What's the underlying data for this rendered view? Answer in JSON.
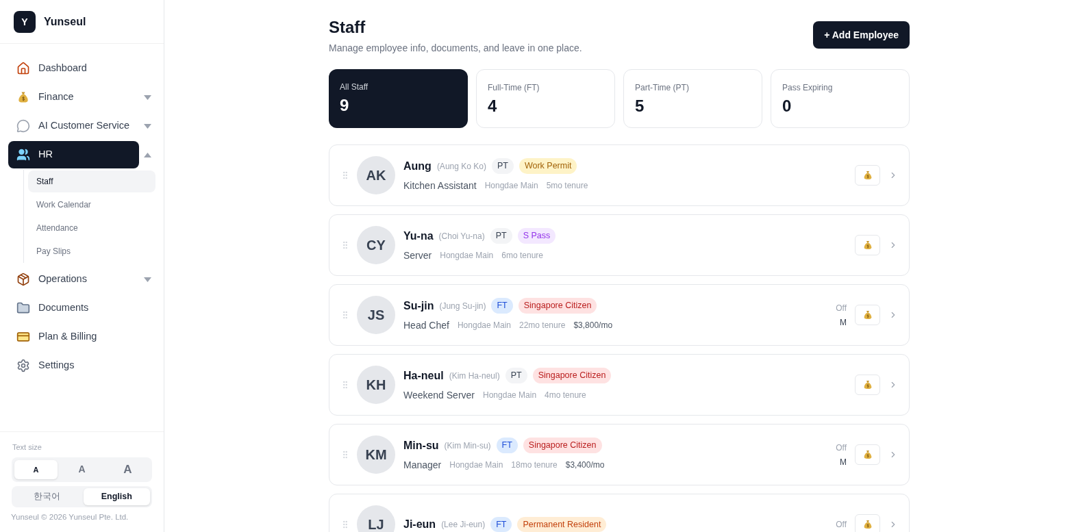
{
  "brand": {
    "logo_letter": "Y",
    "name": "Yunseul"
  },
  "nav": [
    {
      "label": "Dashboard",
      "kind": "link",
      "selected": false
    },
    {
      "label": "Finance",
      "kind": "group",
      "selected": false,
      "expanded": false
    },
    {
      "label": "AI Customer Service",
      "kind": "group",
      "selected": false,
      "expanded": false
    },
    {
      "label": "HR",
      "kind": "group",
      "selected": true,
      "expanded": true,
      "children": [
        {
          "label": "Staff",
          "selected": true
        },
        {
          "label": "Work Calendar",
          "selected": false
        },
        {
          "label": "Attendance",
          "selected": false
        },
        {
          "label": "Pay Slips",
          "selected": false
        }
      ]
    },
    {
      "label": "Operations",
      "kind": "group",
      "selected": false,
      "expanded": false
    },
    {
      "label": "Documents",
      "kind": "link",
      "selected": false
    },
    {
      "label": "Plan & Billing",
      "kind": "link",
      "selected": false
    },
    {
      "label": "Settings",
      "kind": "link",
      "selected": false
    }
  ],
  "text_size": {
    "label": "Text size",
    "options": [
      {
        "label": "A",
        "selected": true
      },
      {
        "label": "A",
        "selected": false
      },
      {
        "label": "A",
        "selected": false
      }
    ]
  },
  "language": [
    {
      "label": "한국어",
      "selected": false
    },
    {
      "label": "English",
      "selected": true
    }
  ],
  "footer": "Yunseul © 2026 Yunseul Pte. Ltd.",
  "page": {
    "title": "Staff",
    "subtitle": "Manage employee info, documents, and leave in one place.",
    "action": "+ Add Employee"
  },
  "stats": [
    {
      "label": "All Staff",
      "value": "9",
      "selected": true
    },
    {
      "label": "Full-Time (FT)",
      "value": "4",
      "selected": false
    },
    {
      "label": "Part-Time (PT)",
      "value": "5",
      "selected": false
    },
    {
      "label": "Pass Expiring",
      "value": "0",
      "selected": false
    }
  ],
  "employees": [
    {
      "initials": "AK",
      "name": "Aung",
      "full_name": "(Aung Ko Ko)",
      "type": {
        "label": "PT",
        "kind": "pt"
      },
      "status": {
        "label": "Work Permit",
        "kind": "work_permit"
      },
      "role": "Kitchen Assistant",
      "branch": "Hongdae Main",
      "tenure": "5mo tenure"
    },
    {
      "initials": "CY",
      "name": "Yu-na",
      "full_name": "(Choi Yu-na)",
      "type": {
        "label": "PT",
        "kind": "pt"
      },
      "status": {
        "label": "S Pass",
        "kind": "s_pass"
      },
      "role": "Server",
      "branch": "Hongdae Main",
      "tenure": "6mo tenure"
    },
    {
      "initials": "JS",
      "name": "Su-jin",
      "full_name": "(Jung Su-jin)",
      "type": {
        "label": "FT",
        "kind": "ft"
      },
      "status": {
        "label": "Singapore Citizen",
        "kind": "citizen"
      },
      "role": "Head Chef",
      "branch": "Hongdae Main",
      "tenure": "22mo tenure",
      "salary": "$3,800/mo",
      "off": {
        "label": "Off",
        "day": "M"
      }
    },
    {
      "initials": "KH",
      "name": "Ha-neul",
      "full_name": "(Kim Ha-neul)",
      "type": {
        "label": "PT",
        "kind": "pt"
      },
      "status": {
        "label": "Singapore Citizen",
        "kind": "citizen"
      },
      "role": "Weekend Server",
      "branch": "Hongdae Main",
      "tenure": "4mo tenure"
    },
    {
      "initials": "KM",
      "name": "Min-su",
      "full_name": "(Kim Min-su)",
      "type": {
        "label": "FT",
        "kind": "ft"
      },
      "status": {
        "label": "Singapore Citizen",
        "kind": "citizen"
      },
      "role": "Manager",
      "branch": "Hongdae Main",
      "tenure": "18mo tenure",
      "salary": "$3,400/mo",
      "off": {
        "label": "Off",
        "day": "M"
      }
    },
    {
      "initials": "LJ",
      "name": "Ji-eun",
      "full_name": "(Lee Ji-eun)",
      "type": {
        "label": "FT",
        "kind": "ft"
      },
      "status": {
        "label": "Permanent Resident",
        "kind": "resident"
      },
      "off": {
        "label": "Off"
      }
    }
  ]
}
